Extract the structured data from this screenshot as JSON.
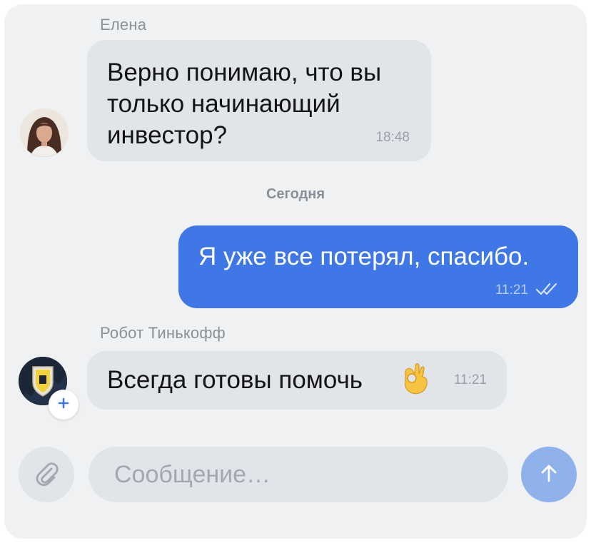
{
  "messages": [
    {
      "sender": "Елена",
      "text": "Верно понимаю, что вы\nтолько начинающий\nинвестор?",
      "time": "18:48"
    },
    {
      "text": "Я уже все потерял, спасибо.",
      "time": "11:21"
    },
    {
      "sender": "Робот Тинькофф",
      "text": "Всегда готовы помочь",
      "time": "11:21",
      "emoji": "ok-hand"
    }
  ],
  "day_separator": "Сегодня",
  "composer": {
    "placeholder": "Сообщение…"
  },
  "colors": {
    "outgoing_bubble": "#3f78e6",
    "incoming_bubble": "#e1e4e8",
    "send_button": "#8fb2ec"
  },
  "icons": {
    "attach": "paperclip-icon",
    "send": "arrow-up-icon",
    "read_status": "double-check-icon",
    "add_badge": "plus-icon"
  }
}
